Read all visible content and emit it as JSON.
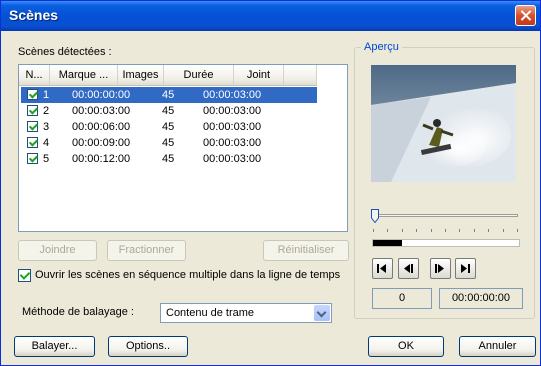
{
  "window": {
    "title": "Scènes"
  },
  "scenes_section": {
    "label": "Scènes détectées :",
    "columns": [
      "N...",
      "Marque ...",
      "Images",
      "Durée",
      "Joint"
    ],
    "rows": [
      {
        "number": "1",
        "mark": "00:00:00:00",
        "images": "45",
        "duration": "00:00:03:00",
        "joint": "",
        "checked": true,
        "selected": true
      },
      {
        "number": "2",
        "mark": "00:00:03:00",
        "images": "45",
        "duration": "00:00:03:00",
        "joint": "",
        "checked": true,
        "selected": false
      },
      {
        "number": "3",
        "mark": "00:00:06:00",
        "images": "45",
        "duration": "00:00:03:00",
        "joint": "",
        "checked": true,
        "selected": false
      },
      {
        "number": "4",
        "mark": "00:00:09:00",
        "images": "45",
        "duration": "00:00:03:00",
        "joint": "",
        "checked": true,
        "selected": false
      },
      {
        "number": "5",
        "mark": "00:00:12:00",
        "images": "45",
        "duration": "00:00:03:00",
        "joint": "",
        "checked": true,
        "selected": false
      }
    ]
  },
  "list_buttons": {
    "join": "Joindre",
    "split": "Fractionner",
    "reset": "Réinitialiser"
  },
  "open_multiple": {
    "label": "Ouvrir les scènes en séquence multiple dans la ligne de temps",
    "checked": true
  },
  "scan_method": {
    "label": "Méthode de balayage :",
    "value": "Contenu de trame"
  },
  "bottom_buttons": {
    "scan": "Balayer...",
    "options": "Options..",
    "ok": "OK",
    "cancel": "Annuler"
  },
  "preview": {
    "title": "Aperçu",
    "frame_number": "0",
    "timecode": "00:00:00:00",
    "slider_position": 0,
    "progress_fraction": 0.2,
    "transport_icons": [
      "go-to-start-icon",
      "step-back-icon",
      "step-forward-icon",
      "go-to-end-icon"
    ]
  },
  "colors": {
    "title_bar": "#0551d6",
    "selection": "#316ac5",
    "group_title": "#0046d5",
    "close_button": "#d6502e"
  }
}
